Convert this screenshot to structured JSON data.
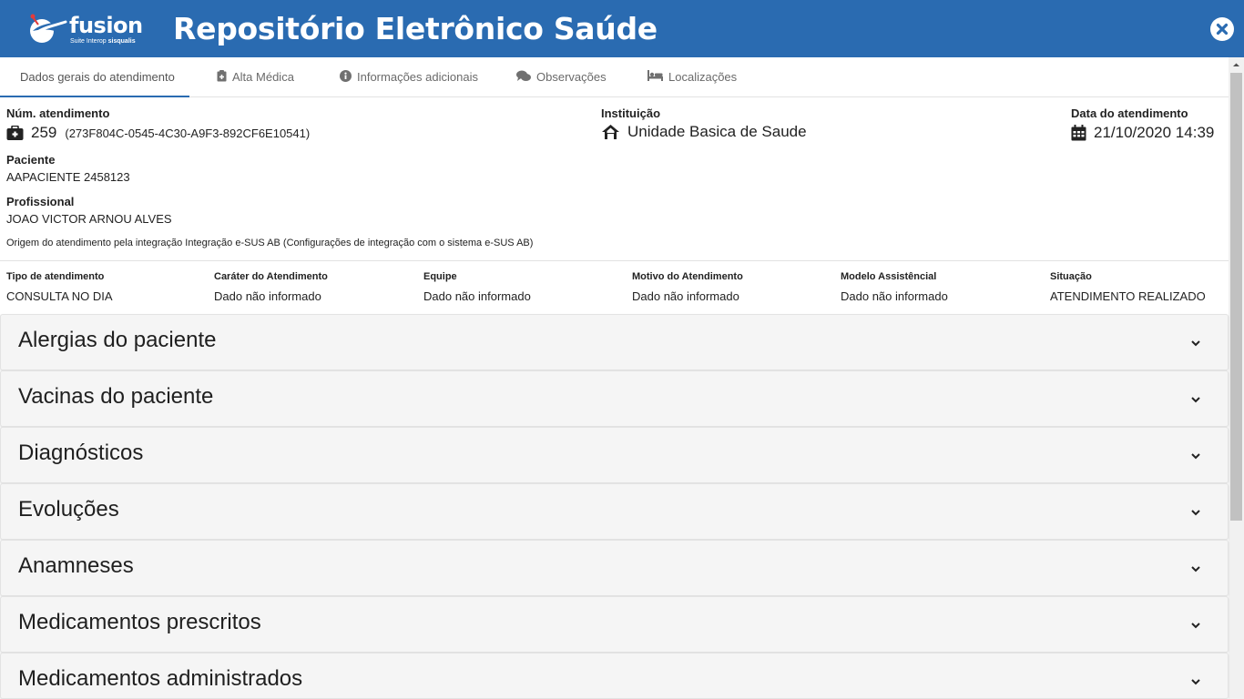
{
  "header": {
    "logo_word": "fusion",
    "logo_sub_prefix": "Suite Interop ",
    "logo_sub_brand": "sisqualis",
    "title": "Repositório Eletrônico Saúde",
    "close_icon": "close-circle-icon"
  },
  "tabs": [
    {
      "label": "Dados gerais do atendimento",
      "icon": "",
      "active": true
    },
    {
      "label": "Alta Médica",
      "icon": "clipboard-icon",
      "active": false
    },
    {
      "label": "Informações adicionais",
      "icon": "info-circle-icon",
      "active": false
    },
    {
      "label": "Observações",
      "icon": "comments-icon",
      "active": false
    },
    {
      "label": "Localizações",
      "icon": "bed-icon",
      "active": false
    }
  ],
  "atendimento": {
    "num_label": "Núm. atendimento",
    "num_value": "259",
    "uuid": "(273F804C-0545-4C30-A9F3-892CF6E10541)",
    "instituicao_label": "Instituição",
    "instituicao_value": "Unidade Basica de Saude",
    "data_label": "Data do atendimento",
    "data_value": "21/10/2020 14:39",
    "paciente_label": "Paciente",
    "paciente_value": "AAPACIENTE 2458123",
    "profissional_label": "Profissional",
    "profissional_value": "JOAO VICTOR ARNOU ALVES",
    "origem": "Origem do atendimento pela integração Integração e-SUS AB (Configurações de integração com o sistema e-SUS AB)"
  },
  "details": [
    {
      "label": "Tipo de atendimento",
      "value": "CONSULTA NO DIA"
    },
    {
      "label": "Caráter do Atendimento",
      "value": "Dado não informado"
    },
    {
      "label": "Equipe",
      "value": "Dado não informado"
    },
    {
      "label": "Motivo do Atendimento",
      "value": "Dado não informado"
    },
    {
      "label": "Modelo Assistêncial",
      "value": "Dado não informado"
    },
    {
      "label": "Situação",
      "value": "ATENDIMENTO REALIZADO"
    }
  ],
  "sections": [
    {
      "title": "Alergias do paciente"
    },
    {
      "title": "Vacinas do paciente"
    },
    {
      "title": "Diagnósticos"
    },
    {
      "title": "Evoluções"
    },
    {
      "title": "Anamneses"
    },
    {
      "title": "Medicamentos prescritos"
    },
    {
      "title": "Medicamentos administrados"
    }
  ],
  "colors": {
    "header_bg": "#2a6bb1",
    "accordion_bg": "#f5f5f5",
    "tab_active_underline": "#2a6bb1"
  }
}
